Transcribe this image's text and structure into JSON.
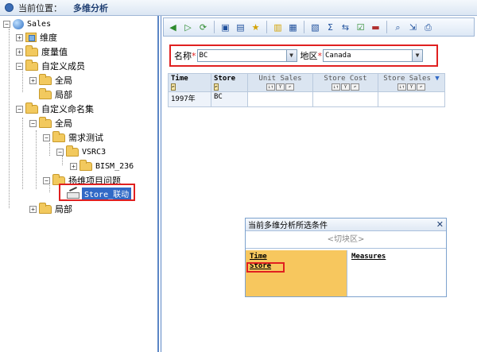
{
  "location": {
    "label": "当前位置：",
    "value": "多维分析"
  },
  "tree": {
    "root": "Sales",
    "items": [
      {
        "label": "维度"
      },
      {
        "label": "度量值"
      },
      {
        "label": "自定义成员"
      },
      {
        "label": "全局"
      },
      {
        "label": "局部"
      },
      {
        "label": "自定义命名集"
      },
      {
        "label": "全局"
      },
      {
        "label": "需求测试"
      },
      {
        "label": "VSRC3"
      },
      {
        "label": "BISM_236"
      },
      {
        "label": "扬维项目问题"
      },
      {
        "label": "Store_联动"
      },
      {
        "label": "局部"
      }
    ]
  },
  "filters": {
    "name_label": "名称",
    "name_value": "BC",
    "region_label": "地区",
    "region_value": "Canada"
  },
  "grid": {
    "row_headers": [
      "Time",
      "Store"
    ],
    "measures": [
      "Unit Sales",
      "Store Cost",
      "Store Sales"
    ],
    "rows": [
      {
        "time": "1997年",
        "store": "BC"
      }
    ]
  },
  "popup": {
    "title": "当前多维分析所选条件",
    "slice": "<切块区>",
    "row_items": [
      "Time",
      "Store"
    ],
    "col_items": [
      "Measures"
    ]
  },
  "colors": {
    "accent": "#3169c6",
    "highlight": "#e02020",
    "rowarea": "#f7c75e"
  }
}
